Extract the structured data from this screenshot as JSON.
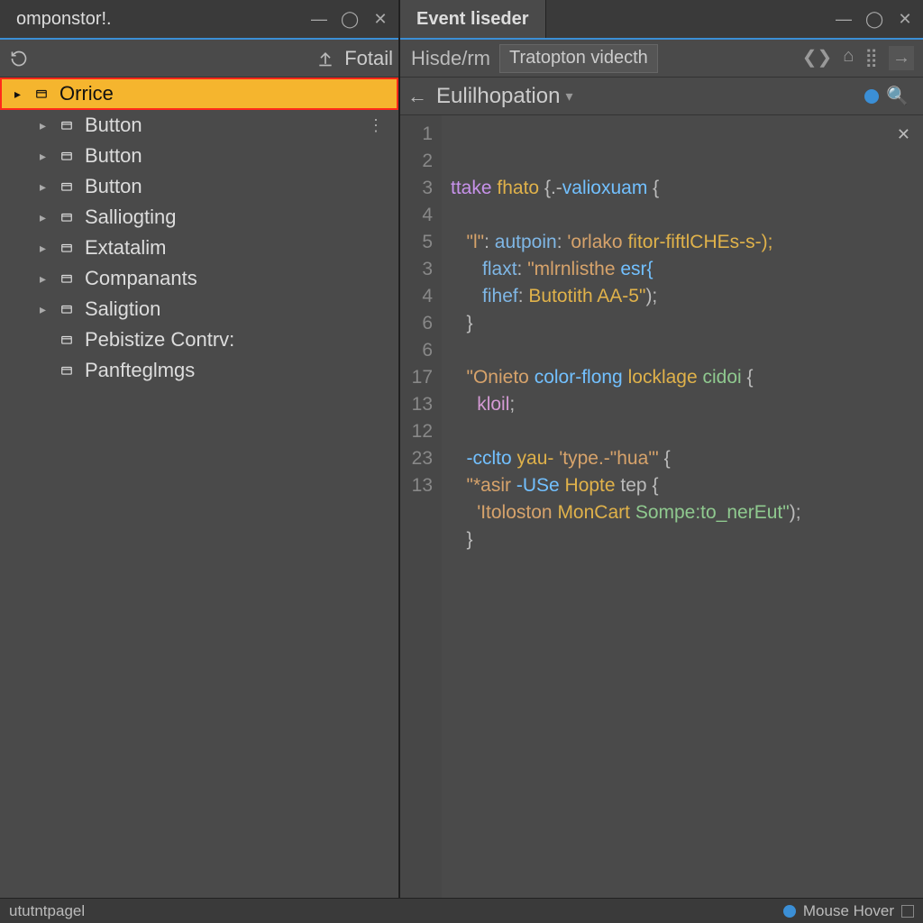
{
  "left": {
    "title": "omponstor!.",
    "toolbar": {
      "upload_label": "Fotail"
    },
    "tree": [
      {
        "label": "Orrice",
        "depth": 0,
        "arrow": true,
        "selected": true,
        "dots": false
      },
      {
        "label": "Button",
        "depth": 1,
        "arrow": true,
        "selected": false,
        "dots": true
      },
      {
        "label": "Button",
        "depth": 1,
        "arrow": true,
        "selected": false,
        "dots": false
      },
      {
        "label": "Button",
        "depth": 1,
        "arrow": true,
        "selected": false,
        "dots": false
      },
      {
        "label": "Salliogting",
        "depth": 1,
        "arrow": true,
        "selected": false,
        "dots": false
      },
      {
        "label": "Extatalim",
        "depth": 1,
        "arrow": true,
        "selected": false,
        "dots": false
      },
      {
        "label": "Companants",
        "depth": 1,
        "arrow": true,
        "selected": false,
        "dots": false
      },
      {
        "label": "Saligtion",
        "depth": 1,
        "arrow": true,
        "selected": false,
        "dots": false
      },
      {
        "label": "Pebistize Contrv:",
        "depth": 1,
        "arrow": false,
        "selected": false,
        "dots": false
      },
      {
        "label": "Panfteglmgs",
        "depth": 1,
        "arrow": false,
        "selected": false,
        "dots": false
      }
    ]
  },
  "right": {
    "title": "Event liseder",
    "path": {
      "seg1": "Hisde/rm",
      "field": "Tratopton videcth"
    },
    "breadcrumb": "Eulilhopation",
    "gutter": [
      "1",
      "2",
      "3",
      "4",
      "5",
      "3",
      "4",
      "6",
      "6",
      "17",
      "13",
      "12",
      "23",
      "13"
    ],
    "code": {
      "l1": {
        "a": "ttake",
        "b": "fhato",
        "c": "{.-",
        "d": "valioxuam",
        "e": "{"
      },
      "l3": {
        "a": "\"l\"",
        "b": "autpoin",
        "c": "'orlako",
        "d": "fitor-fiftlCHEs-s-);"
      },
      "l4": {
        "a": "flaxt",
        "b": "\"mlrnlisthe",
        "c": "esr{"
      },
      "l5": {
        "a": "fihef",
        "b": "Butotith AA-5\"",
        "c": ");"
      },
      "l6": {
        "a": "}"
      },
      "l8": {
        "a": "\"Onieto",
        "b": "color-flong",
        "c": "locklage",
        "d": "cidoi",
        "e": "{"
      },
      "l9": {
        "a": "kloil",
        "b": ";"
      },
      "l11": {
        "a": "-cclto",
        "b": "yau-",
        "c": "'type.-\"hua'\"",
        "d": "{"
      },
      "l12": {
        "a": "\"*asir",
        "b": "-USe",
        "c": "Hopte",
        "d": "tep {"
      },
      "l13": {
        "a": "'Itoloston",
        "b": "MonCart",
        "c": "Sompe:to_nerEut\"",
        "d": ");"
      },
      "l14": {
        "a": "}"
      }
    }
  },
  "status": {
    "left": "ututntpagel",
    "right": "Mouse Hover"
  }
}
